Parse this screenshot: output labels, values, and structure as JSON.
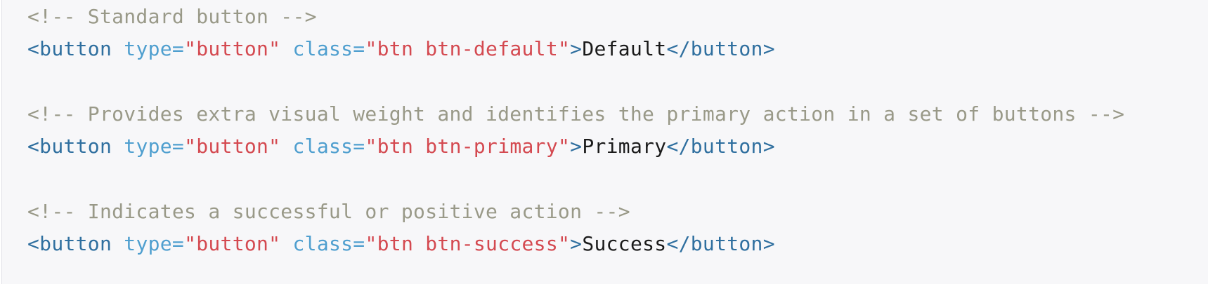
{
  "code": {
    "block1": {
      "comment": "<!-- Standard button -->",
      "open_tag": "<button",
      "attr1_name": "type=",
      "attr1_value": "\"button\"",
      "attr2_name": "class=",
      "attr2_value": "\"btn btn-default\"",
      "close_open": ">",
      "text": "Default",
      "close_tag": "</button>"
    },
    "block2": {
      "comment": "<!-- Provides extra visual weight and identifies the primary action in a set of buttons -->",
      "open_tag": "<button",
      "attr1_name": "type=",
      "attr1_value": "\"button\"",
      "attr2_name": "class=",
      "attr2_value": "\"btn btn-primary\"",
      "close_open": ">",
      "text": "Primary",
      "close_tag": "</button>"
    },
    "block3": {
      "comment": "<!-- Indicates a successful or positive action -->",
      "open_tag": "<button",
      "attr1_name": "type=",
      "attr1_value": "\"button\"",
      "attr2_name": "class=",
      "attr2_value": "\"btn btn-success\"",
      "close_open": ">",
      "text": "Success",
      "close_tag": "</button>"
    }
  },
  "colors": {
    "background": "#f7f7f9",
    "comment": "#999988",
    "tag": "#2f6f9f",
    "attribute": "#4f9fcf",
    "string": "#d44950",
    "text": "#1a1a1a"
  }
}
